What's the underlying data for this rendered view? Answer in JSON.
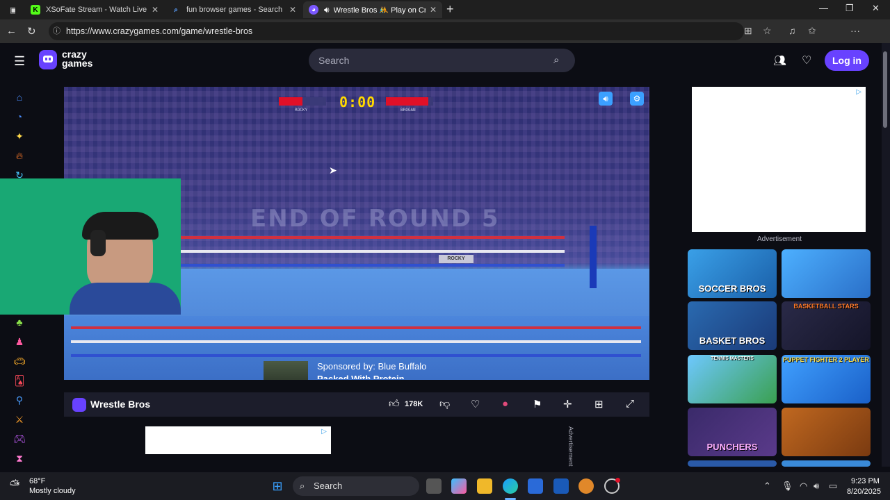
{
  "tabs": [
    {
      "label": "XSoFate Stream - Watch Live on K",
      "icon": "K",
      "icon_color": "#53fc18"
    },
    {
      "label": "fun browser games - Search",
      "icon": "⌕",
      "icon_color": "#5aa0ff"
    },
    {
      "label": "Wrestle Bros 🤼 Play on Cra",
      "icon": "◕",
      "icon_color": "#7b58ff"
    }
  ],
  "url": "https://www.crazygames.com/game/wrestle-bros",
  "site": {
    "logo_line1": "crazy",
    "logo_line2": "games",
    "search_placeholder": "Search",
    "login_label": "Log in"
  },
  "game": {
    "timer": "0:00",
    "player1": "ROCKY",
    "player2": "BROGAN",
    "player1_health": 0.5,
    "player2_health": 0.9,
    "round_text": "END OF ROUND 5",
    "sign_text": "ROCKY",
    "sponsor_line1": "Sponsored by: Blue Buffalo",
    "sponsor_line2": "Packed With Protein"
  },
  "gamebar": {
    "title": "Wrestle Bros",
    "likes": "178K"
  },
  "ads": {
    "label": "Advertisement",
    "vertical_label": "Advertisement"
  },
  "thumbnails": [
    {
      "label": "SOCCER BROS",
      "color1": "#3aa0e8",
      "color2": "#1a5fa8"
    },
    {
      "label": "",
      "color1": "#4db0ff",
      "color2": "#2a6fc8"
    },
    {
      "label": "BASKET BROS",
      "color1": "#2a6ab0",
      "color2": "#1a3a78"
    },
    {
      "label": "BASKETBALL STARS",
      "color1": "#2a2a48",
      "color2": "#141428"
    },
    {
      "label": "TENNIS MASTERS",
      "color1": "#6ec8ff",
      "color2": "#3aa050"
    },
    {
      "label": "PUPPET FIGHTER 2 PLAYER",
      "color1": "#40a0ff",
      "color2": "#1a60c8"
    },
    {
      "label": "PUNCHERS",
      "color1": "#3a2a6a",
      "color2": "#5a3a8a"
    },
    {
      "label": "",
      "color1": "#c06820",
      "color2": "#7a3a10"
    }
  ],
  "taskbar": {
    "weather_temp": "68°F",
    "weather_desc": "Mostly cloudy",
    "search_label": "Search",
    "time": "9:23 PM",
    "date": "8/20/2025"
  }
}
